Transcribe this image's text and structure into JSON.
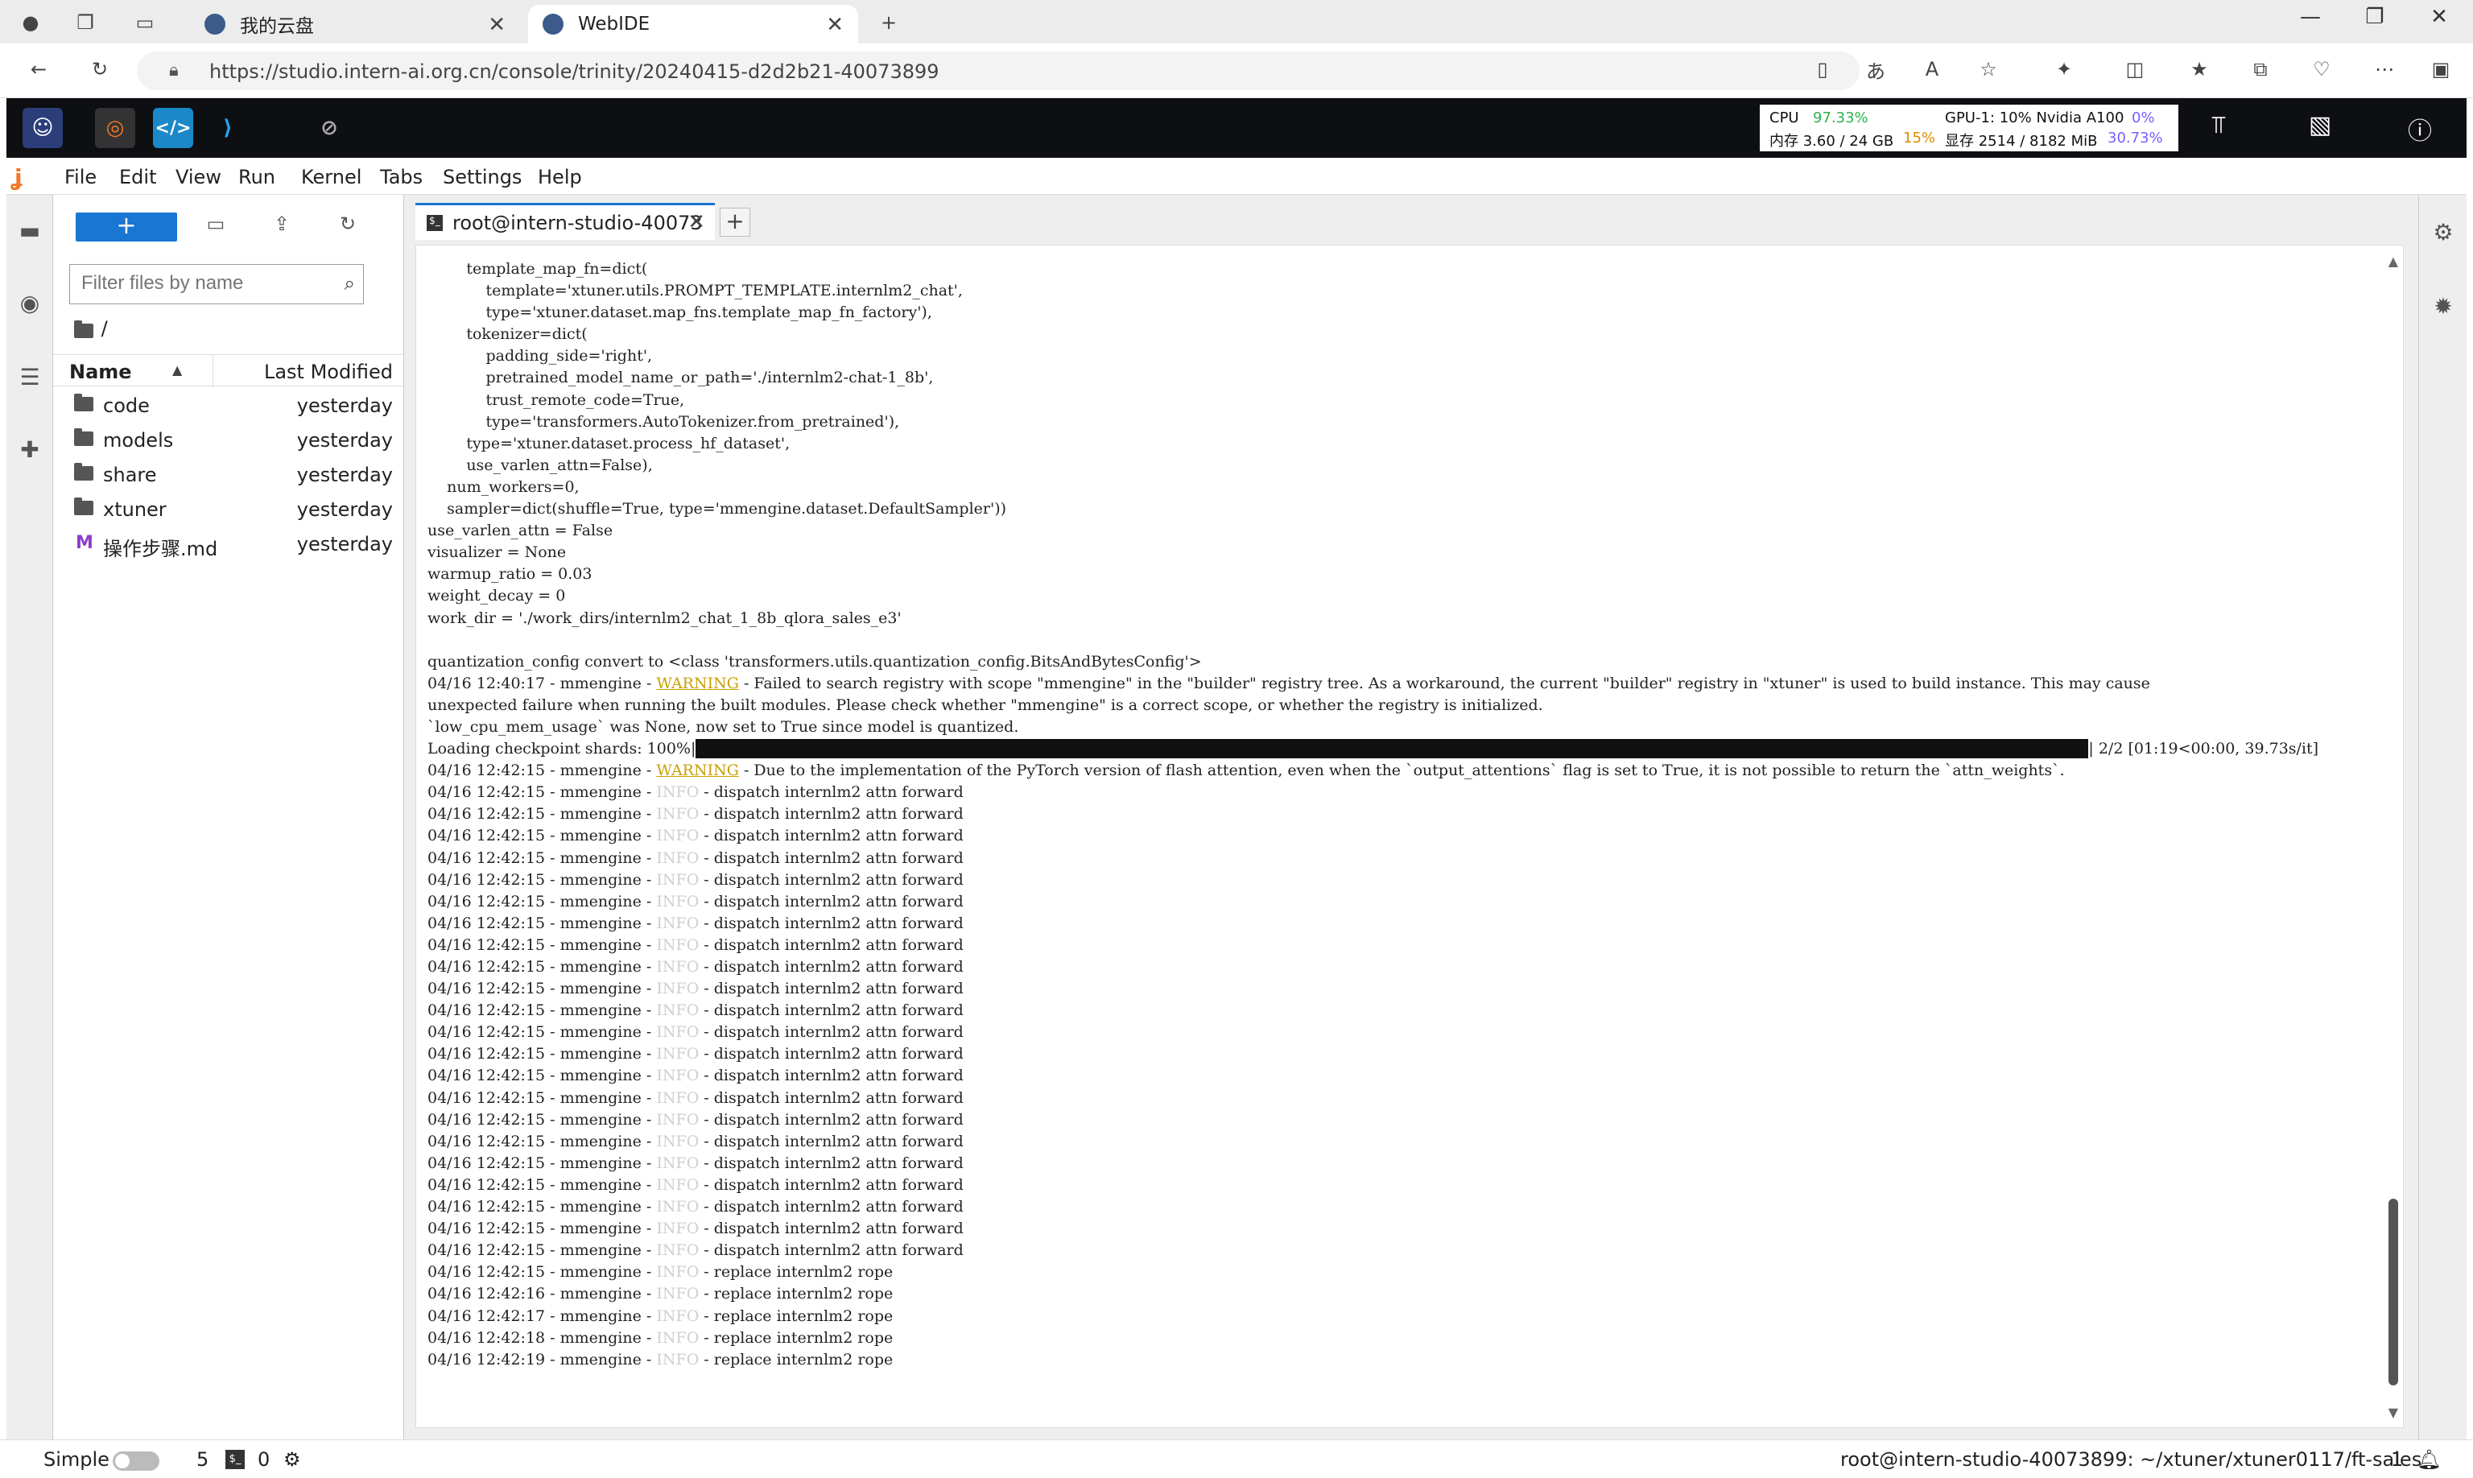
{
  "browser": {
    "tabs": [
      {
        "label": "我的云盘"
      },
      {
        "label": "WebIDE"
      }
    ],
    "url": "https://studio.intern-ai.org.cn/console/trinity/20240415-d2d2b21-40073899"
  },
  "topbar": {
    "cpu_label": "CPU",
    "cpu_value": "97.33%",
    "mem_label": "内存 3.60 / 24 GB",
    "mem_pct": "15%",
    "gpu_label": "GPU-1: 10% Nvidia A100",
    "gpu_pct": "0%",
    "vram_label": "显存 2514 / 8182 MiB",
    "vram_pct": "30.73%"
  },
  "menu": {
    "items": [
      "File",
      "Edit",
      "View",
      "Run",
      "Kernel",
      "Tabs",
      "Settings",
      "Help"
    ]
  },
  "filebrowser": {
    "new_label": "+",
    "filter_placeholder": "Filter files by name",
    "breadcrumb": "/",
    "col_name": "Name",
    "col_modified": "Last Modified",
    "files": [
      {
        "name": "code",
        "modified": "yesterday",
        "type": "folder"
      },
      {
        "name": "models",
        "modified": "yesterday",
        "type": "folder"
      },
      {
        "name": "share",
        "modified": "yesterday",
        "type": "folder"
      },
      {
        "name": "xtuner",
        "modified": "yesterday",
        "type": "folder"
      },
      {
        "name": "操作步骤.md",
        "modified": "yesterday",
        "type": "markdown"
      }
    ]
  },
  "terminal": {
    "tab_label": "root@intern-studio-40073",
    "lines": [
      {
        "t": "        template_map_fn=dict("
      },
      {
        "t": "            template='xtuner.utils.PROMPT_TEMPLATE.internlm2_chat',"
      },
      {
        "t": "            type='xtuner.dataset.map_fns.template_map_fn_factory'),"
      },
      {
        "t": "        tokenizer=dict("
      },
      {
        "t": "            padding_side='right',"
      },
      {
        "t": "            pretrained_model_name_or_path='./internlm2-chat-1_8b',"
      },
      {
        "t": "            trust_remote_code=True,"
      },
      {
        "t": "            type='transformers.AutoTokenizer.from_pretrained'),"
      },
      {
        "t": "        type='xtuner.dataset.process_hf_dataset',"
      },
      {
        "t": "        use_varlen_attn=False),"
      },
      {
        "t": "    num_workers=0,"
      },
      {
        "t": "    sampler=dict(shuffle=True, type='mmengine.dataset.DefaultSampler'))"
      },
      {
        "t": "use_varlen_attn = False"
      },
      {
        "t": "visualizer = None"
      },
      {
        "t": "warmup_ratio = 0.03"
      },
      {
        "t": "weight_decay = 0"
      },
      {
        "t": "work_dir = './work_dirs/internlm2_chat_1_8b_qlora_sales_e3'"
      },
      {
        "t": ""
      },
      {
        "t": "quantization_config convert to <class 'transformers.utils.quantization_config.BitsAndBytesConfig'>"
      },
      {
        "pre": "04/16 12:40:17 - mmengine - ",
        "lvl": "WARNING",
        "post": " - Failed to search registry with scope \"mmengine\" in the \"builder\" registry tree. As a workaround, the current \"builder\" registry in \"xtuner\" is used to build instance. This may cause"
      },
      {
        "t": "unexpected failure when running the built modules. Please check whether \"mmengine\" is a correct scope, or whether the registry is initialized."
      },
      {
        "t": "`low_cpu_mem_usage` was None, now set to True since model is quantized."
      },
      {
        "progress": true,
        "pre": "Loading checkpoint shards: 100%|",
        "post": "| 2/2 [01:19<00:00, 39.73s/it]"
      },
      {
        "pre": "04/16 12:42:15 - mmengine - ",
        "lvl": "WARNING",
        "post": " - Due to the implementation of the PyTorch version of flash attention, even when the `output_attentions` flag is set to True, it is not possible to return the `attn_weights`."
      },
      {
        "pre": "04/16 12:42:15 - mmengine - ",
        "lvl": "INFO",
        "post": " - dispatch internlm2 attn forward"
      },
      {
        "pre": "04/16 12:42:15 - mmengine - ",
        "lvl": "INFO",
        "post": " - dispatch internlm2 attn forward"
      },
      {
        "pre": "04/16 12:42:15 - mmengine - ",
        "lvl": "INFO",
        "post": " - dispatch internlm2 attn forward"
      },
      {
        "pre": "04/16 12:42:15 - mmengine - ",
        "lvl": "INFO",
        "post": " - dispatch internlm2 attn forward"
      },
      {
        "pre": "04/16 12:42:15 - mmengine - ",
        "lvl": "INFO",
        "post": " - dispatch internlm2 attn forward"
      },
      {
        "pre": "04/16 12:42:15 - mmengine - ",
        "lvl": "INFO",
        "post": " - dispatch internlm2 attn forward"
      },
      {
        "pre": "04/16 12:42:15 - mmengine - ",
        "lvl": "INFO",
        "post": " - dispatch internlm2 attn forward"
      },
      {
        "pre": "04/16 12:42:15 - mmengine - ",
        "lvl": "INFO",
        "post": " - dispatch internlm2 attn forward"
      },
      {
        "pre": "04/16 12:42:15 - mmengine - ",
        "lvl": "INFO",
        "post": " - dispatch internlm2 attn forward"
      },
      {
        "pre": "04/16 12:42:15 - mmengine - ",
        "lvl": "INFO",
        "post": " - dispatch internlm2 attn forward"
      },
      {
        "pre": "04/16 12:42:15 - mmengine - ",
        "lvl": "INFO",
        "post": " - dispatch internlm2 attn forward"
      },
      {
        "pre": "04/16 12:42:15 - mmengine - ",
        "lvl": "INFO",
        "post": " - dispatch internlm2 attn forward"
      },
      {
        "pre": "04/16 12:42:15 - mmengine - ",
        "lvl": "INFO",
        "post": " - dispatch internlm2 attn forward"
      },
      {
        "pre": "04/16 12:42:15 - mmengine - ",
        "lvl": "INFO",
        "post": " - dispatch internlm2 attn forward"
      },
      {
        "pre": "04/16 12:42:15 - mmengine - ",
        "lvl": "INFO",
        "post": " - dispatch internlm2 attn forward"
      },
      {
        "pre": "04/16 12:42:15 - mmengine - ",
        "lvl": "INFO",
        "post": " - dispatch internlm2 attn forward"
      },
      {
        "pre": "04/16 12:42:15 - mmengine - ",
        "lvl": "INFO",
        "post": " - dispatch internlm2 attn forward"
      },
      {
        "pre": "04/16 12:42:15 - mmengine - ",
        "lvl": "INFO",
        "post": " - dispatch internlm2 attn forward"
      },
      {
        "pre": "04/16 12:42:15 - mmengine - ",
        "lvl": "INFO",
        "post": " - dispatch internlm2 attn forward"
      },
      {
        "pre": "04/16 12:42:15 - mmengine - ",
        "lvl": "INFO",
        "post": " - dispatch internlm2 attn forward"
      },
      {
        "pre": "04/16 12:42:15 - mmengine - ",
        "lvl": "INFO",
        "post": " - dispatch internlm2 attn forward"
      },
      {
        "pre": "04/16 12:42:15 - mmengine - ",
        "lvl": "INFO",
        "post": " - dispatch internlm2 attn forward"
      },
      {
        "pre": "04/16 12:42:15 - mmengine - ",
        "lvl": "INFO",
        "post": " - replace internlm2 rope"
      },
      {
        "pre": "04/16 12:42:16 - mmengine - ",
        "lvl": "INFO",
        "post": " - replace internlm2 rope"
      },
      {
        "pre": "04/16 12:42:17 - mmengine - ",
        "lvl": "INFO",
        "post": " - replace internlm2 rope"
      },
      {
        "pre": "04/16 12:42:18 - mmengine - ",
        "lvl": "INFO",
        "post": " - replace internlm2 rope"
      },
      {
        "pre": "04/16 12:42:19 - mmengine - ",
        "lvl": "INFO",
        "post": " - replace internlm2 rope"
      }
    ],
    "progress_fraction": 1.0
  },
  "statusbar": {
    "simple_label": "Simple",
    "count_a": "5",
    "count_b": "0",
    "path": "root@intern-studio-40073899: ~/xtuner/xtuner0117/ft-sales",
    "notifications": "1"
  },
  "colors": {
    "accent": "#1976d2",
    "warning": "#c9a000",
    "info": "#cfcfcf",
    "topbar_bg": "#0e0f12"
  }
}
